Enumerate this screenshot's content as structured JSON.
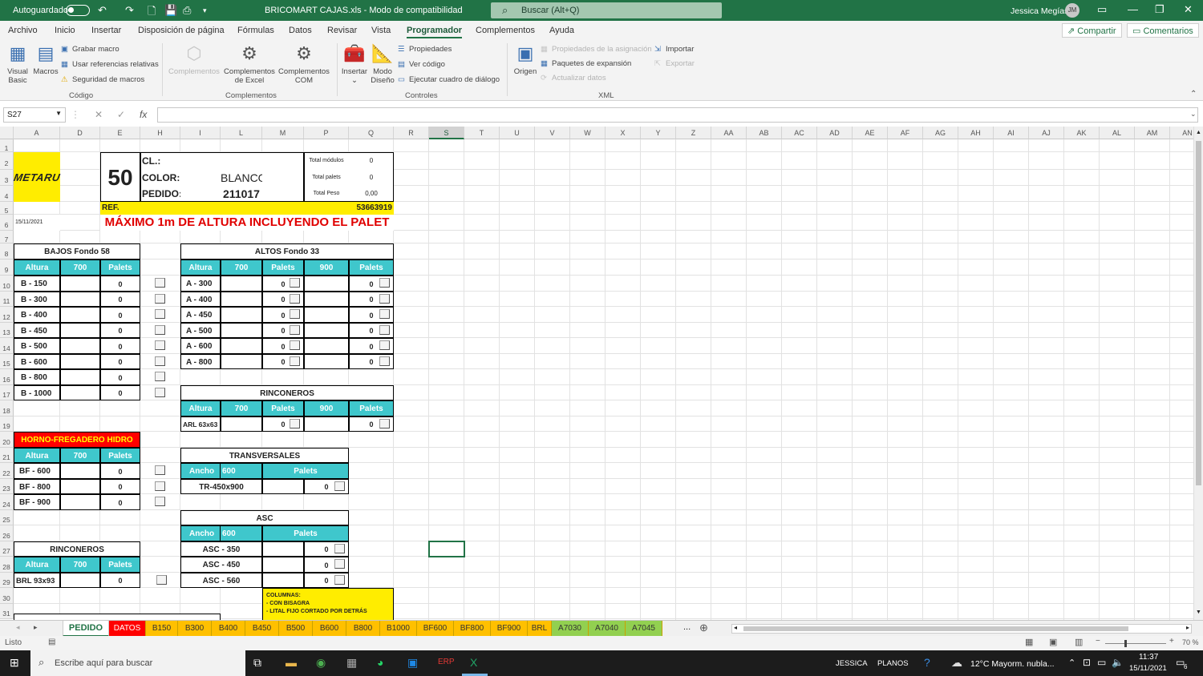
{
  "titlebar": {
    "autosave": "Autoguardado",
    "doc_title": "BRICOMART CAJAS.xls - Modo de compatibilidad",
    "search": "Buscar (Alt+Q)",
    "user": "Jessica Megías",
    "initials": "JM"
  },
  "menu": [
    "Archivo",
    "Inicio",
    "Insertar",
    "Disposición de página",
    "Fórmulas",
    "Datos",
    "Revisar",
    "Vista",
    "Programador",
    "Complementos",
    "Ayuda"
  ],
  "share": {
    "share": "Compartir",
    "comments": "Comentarios"
  },
  "ribbon": {
    "visual_basic": "Visual Basic",
    "macros": "Macros",
    "grabar": "Grabar macro",
    "usar_ref": "Usar referencias relativas",
    "seguridad": "Seguridad de macros",
    "g_codigo": "Código",
    "complementos": "Complementos",
    "compl_excel": "Complementos de Excel",
    "compl_com": "Complementos COM",
    "g_complementos": "Complementos",
    "insertar": "Insertar",
    "modo_diseno": "Modo Diseño",
    "propiedades": "Propiedades",
    "ver_codigo": "Ver código",
    "ejecutar": "Ejecutar cuadro de diálogo",
    "g_controles": "Controles",
    "origen": "Origen",
    "prop_asig": "Propiedades de la asignación",
    "paquetes": "Paquetes de expansión",
    "actualizar": "Actualizar datos",
    "importar": "Importar",
    "exportar": "Exportar",
    "g_xml": "XML"
  },
  "formula": {
    "namebox": "S27",
    "fx": "fx"
  },
  "columns": [
    "A",
    "D",
    "E",
    "H",
    "I",
    "L",
    "M",
    "P",
    "Q",
    "R",
    "S",
    "T",
    "U",
    "V",
    "W",
    "X",
    "Y",
    "Z",
    "AA",
    "AB",
    "AC",
    "AD",
    "AE",
    "AF",
    "AG",
    "AH",
    "AI",
    "AJ",
    "AK",
    "AL",
    "AM",
    "AN"
  ],
  "rows": [
    "1",
    "2",
    "3",
    "4",
    "5",
    "6",
    "7",
    "8",
    "9",
    "10",
    "11",
    "12",
    "13",
    "14",
    "15",
    "16",
    "17",
    "18",
    "19",
    "20",
    "21",
    "22",
    "23",
    "24",
    "25",
    "26",
    "27",
    "28",
    "29",
    "30",
    "31"
  ],
  "sheet": {
    "logo": "METARU",
    "num": "50",
    "cl": "CL.:",
    "color_lbl": "COLOR:",
    "color_val": "BLANCO",
    "pedido_lbl": "PEDIDO:",
    "pedido_val": "211017",
    "tot_mod": "Total módulos",
    "tot_mod_v": "0",
    "tot_pal": "Total palets",
    "tot_pal_v": "0",
    "tot_peso": "Total Peso",
    "tot_peso_v": "0,00",
    "ref": "REF.",
    "ref_v": "53663919",
    "date": "15/11/2021",
    "maximo": "MÁXIMO 1m DE ALTURA INCLUYENDO EL PALET",
    "bajos_title": "BAJOS Fondo 58",
    "altura": "Altura",
    "c700": "700",
    "palets": "Palets",
    "c900": "900",
    "bajos_rows": [
      {
        "label": "B  -  150",
        "val": "0"
      },
      {
        "label": "B  -  300",
        "val": "0"
      },
      {
        "label": "B  -  400",
        "val": "0"
      },
      {
        "label": "B  -  450",
        "val": "0"
      },
      {
        "label": "B  -  500",
        "val": "0"
      },
      {
        "label": "B  -  600",
        "val": "0"
      },
      {
        "label": "B  -  800",
        "val": "0"
      },
      {
        "label": "B  - 1000",
        "val": "0"
      }
    ],
    "altos_title": "ALTOS   Fondo 33",
    "altos_rows": [
      {
        "label": "A  -  300",
        "v1": "0",
        "v2": "0"
      },
      {
        "label": "A  -  400",
        "v1": "0",
        "v2": "0"
      },
      {
        "label": "A  -  450",
        "v1": "0",
        "v2": "0"
      },
      {
        "label": "A  -  500",
        "v1": "0",
        "v2": "0"
      },
      {
        "label": "A  -  600",
        "v1": "0",
        "v2": "0"
      },
      {
        "label": "A  -  800",
        "v1": "0",
        "v2": "0"
      }
    ],
    "rinc1_title": "RINCONEROS",
    "arl": "ARL 63x63",
    "arl_v1": "0",
    "arl_v2": "0",
    "horno_title": "HORNO-FREGADERO HIDRO",
    "horno_rows": [
      {
        "label": "BF  -  600",
        "val": "0"
      },
      {
        "label": "BF  -  800",
        "val": "0"
      },
      {
        "label": "BF  -  900",
        "val": "0"
      }
    ],
    "trans_title": "TRANSVERSALES",
    "ancho": "Ancho",
    "c600": "600",
    "tr_label": "TR-450x900",
    "tr_v": "0",
    "asc_title": "ASC",
    "asc_rows": [
      {
        "label": "ASC - 350",
        "val": "0"
      },
      {
        "label": "ASC - 450",
        "val": "0"
      },
      {
        "label": "ASC - 560",
        "val": "0"
      }
    ],
    "rinc2_title": "RINCONEROS",
    "brl": "BRL 93x93",
    "brl_v": "0",
    "columnas_note": "COLUMNAS:",
    "columnas_l1": "- CON BISAGRA",
    "columnas_l2": "- LITAL FIJO CORTADO POR DETRÁS"
  },
  "tabs": [
    {
      "name": "PEDIDO",
      "color": "#ffffff"
    },
    {
      "name": "DATOS",
      "color": "#ff0000"
    },
    {
      "name": "B150",
      "color": "#ffc000"
    },
    {
      "name": "B300",
      "color": "#ffc000"
    },
    {
      "name": "B400",
      "color": "#ffc000"
    },
    {
      "name": "B450",
      "color": "#ffc000"
    },
    {
      "name": "B500",
      "color": "#ffc000"
    },
    {
      "name": "B600",
      "color": "#ffc000"
    },
    {
      "name": "B800",
      "color": "#ffc000"
    },
    {
      "name": "B1000",
      "color": "#ffc000"
    },
    {
      "name": "BF600",
      "color": "#ffc000"
    },
    {
      "name": "BF800",
      "color": "#ffc000"
    },
    {
      "name": "BF900",
      "color": "#ffc000"
    },
    {
      "name": "BRL",
      "color": "#ffc000"
    },
    {
      "name": "A7030",
      "color": "#92d050"
    },
    {
      "name": "A7040",
      "color": "#92d050"
    },
    {
      "name": "A7045",
      "color": "#92d050"
    }
  ],
  "tab_more": "...",
  "status": {
    "ready": "Listo",
    "zoom": "70 %"
  },
  "taskbar": {
    "search": "Escribe aquí para buscar",
    "jessica": "JESSICA",
    "planos": "PLANOS",
    "weather": "12°C  Mayorm. nubla...",
    "time": "11:37",
    "date": "15/11/2021",
    "notif": "6"
  }
}
